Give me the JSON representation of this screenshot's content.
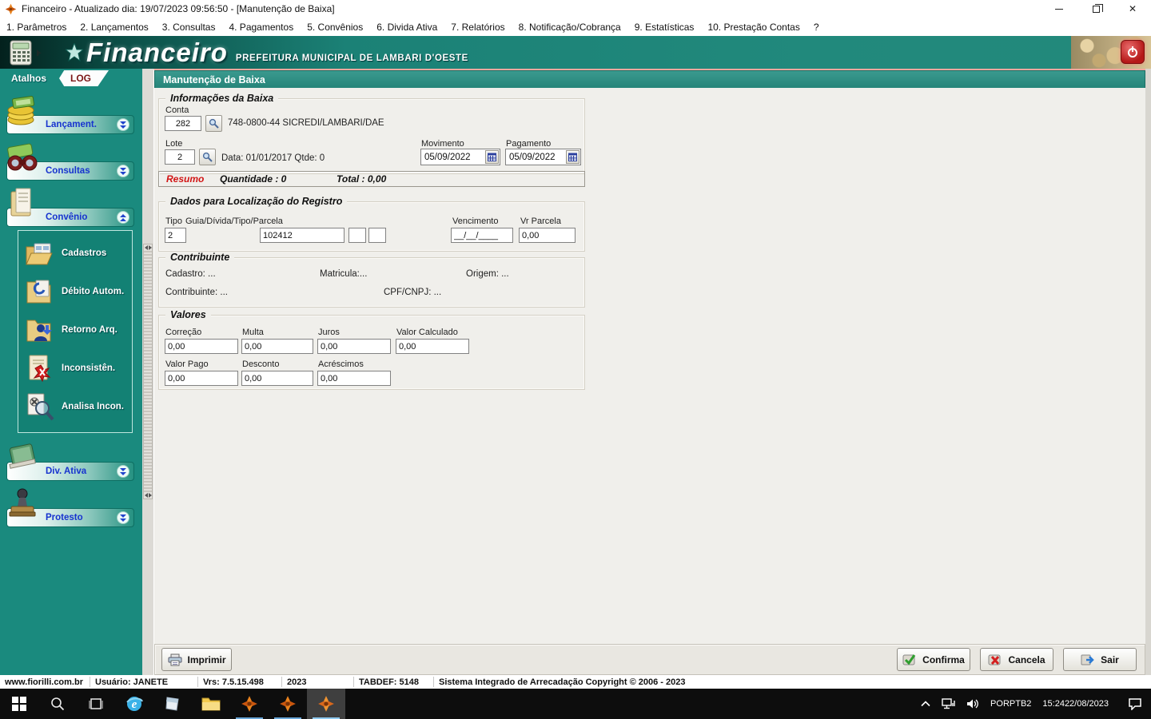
{
  "window": {
    "title": "Financeiro - Atualizado dia: 19/07/2023 09:56:50 - [Manutenção de Baixa]"
  },
  "menubar": {
    "items": [
      "1. Parâmetros",
      "2. Lançamentos",
      "3. Consultas",
      "4. Pagamentos",
      "5. Convênios",
      "6. Divida Ativa",
      "7. Relatórios",
      "8. Notificação/Cobrança",
      "9. Estatísticas",
      "10. Prestação Contas",
      "?"
    ]
  },
  "header": {
    "logo_text": "Financeiro",
    "subtitle": "PREFEITURA MUNICIPAL DE LAMBARI D'OESTE"
  },
  "sidebar": {
    "tabs": [
      {
        "label": "Atalhos"
      },
      {
        "label": "LOG"
      }
    ],
    "groups": [
      {
        "label": "Lançament."
      },
      {
        "label": "Consultas"
      },
      {
        "label": "Convênio",
        "children": [
          "Cadastros",
          "Débito Autom.",
          "Retorno Arq.",
          "Inconsistên.",
          "Analisa Incon."
        ]
      },
      {
        "label": "Div. Ativa"
      },
      {
        "label": "Protesto"
      }
    ]
  },
  "panel": {
    "title": "Manutenção de Baixa",
    "info_baixa": {
      "title": "Informações da Baixa",
      "conta_label": "Conta",
      "conta_value": "282",
      "conta_desc": "748-0800-44 SICREDI/LAMBARI/DAE",
      "lote_label": "Lote",
      "lote_value": "2",
      "lote_desc": "Data: 01/01/2017 Qtde: 0",
      "movimento_label": "Movimento",
      "movimento_value": "05/09/2022",
      "pagamento_label": "Pagamento",
      "pagamento_value": "05/09/2022"
    },
    "resumo": {
      "label": "Resumo",
      "quantidade": "Quantidade : 0",
      "total": "Total : 0,00"
    },
    "localizacao": {
      "title": "Dados para Localização do Registro",
      "tipo_label": "Tipo",
      "tipo_value": "2",
      "guia_label": "Guia/Dívida/Tipo/Parcela",
      "guia_value": "102412",
      "vencimento_label": "Vencimento",
      "vencimento_value": "__/__/____",
      "vr_parcela_label": "Vr Parcela",
      "vr_parcela_value": "0,00"
    },
    "contribuinte": {
      "title": "Contribuinte",
      "cadastro": "Cadastro: ...",
      "matricula": "Matricula:...",
      "origem": "Origem: ...",
      "contribuinte": "Contribuinte: ...",
      "cpf_cnpj": "CPF/CNPJ: ..."
    },
    "valores": {
      "title": "Valores",
      "fields_row1": [
        {
          "label": "Correção",
          "value": "0,00"
        },
        {
          "label": "Multa",
          "value": "0,00"
        },
        {
          "label": "Juros",
          "value": "0,00"
        },
        {
          "label": "Valor Calculado",
          "value": "0,00"
        }
      ],
      "fields_row2": [
        {
          "label": "Valor Pago",
          "value": "0,00"
        },
        {
          "label": "Desconto",
          "value": "0,00"
        },
        {
          "label": "Acréscimos",
          "value": "0,00"
        }
      ]
    },
    "buttons": {
      "imprimir": "Imprimir",
      "confirma": "Confirma",
      "cancela": "Cancela",
      "sair": "Sair"
    }
  },
  "statusbar": {
    "items": [
      "www.fiorilli.com.br",
      "Usuário: JANETE",
      "Vrs: 7.5.15.498",
      "2023",
      "TABDEF: 5148",
      "Sistema Integrado de Arrecadação Copyright © 2006 - 2023"
    ]
  },
  "taskbar": {
    "lang_line1": "POR",
    "lang_line2": "PTB2",
    "time": "15:24",
    "date": "22/08/2023"
  },
  "colors": {
    "teal": "#1a8a7e",
    "panel_header": "#2c8e83",
    "accent_blue": "#1733cf",
    "resumo_red": "#d21414",
    "taskbar": "#0d0d0d",
    "fiorilli_orange": "#e8821e"
  }
}
